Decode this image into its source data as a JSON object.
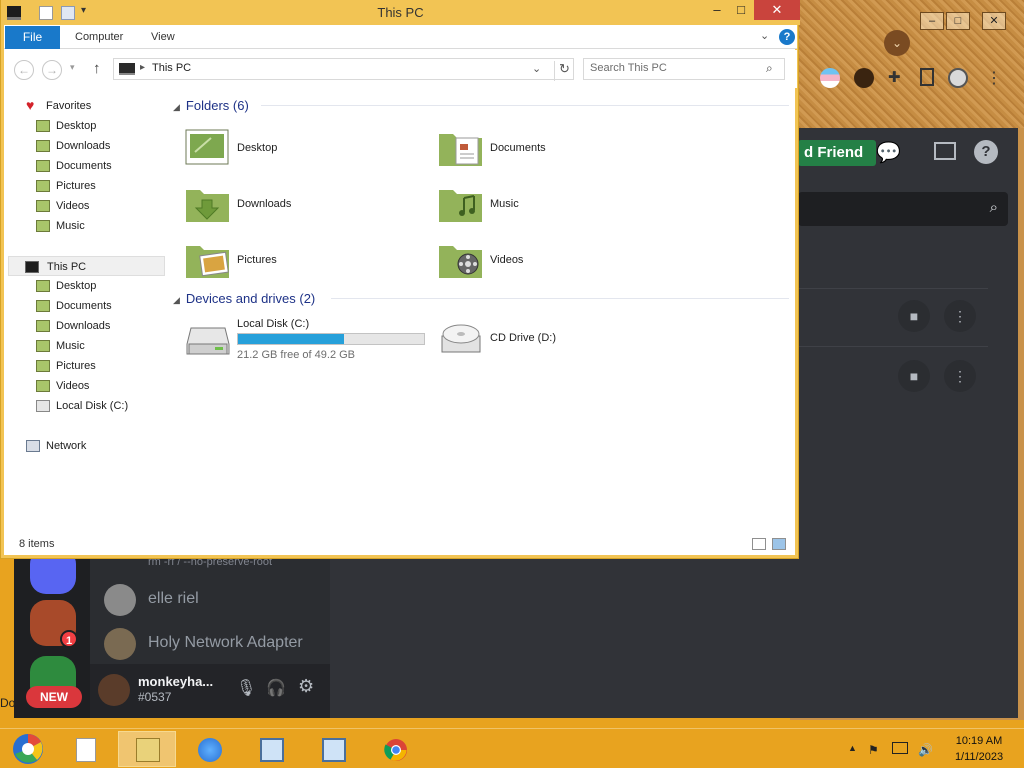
{
  "explorer": {
    "title": "This PC",
    "ribbon": {
      "file_tab": "File",
      "tabs": [
        "Computer",
        "View"
      ]
    },
    "address": {
      "path": "This PC"
    },
    "search": {
      "placeholder": "Search This PC"
    },
    "navpane": {
      "favorites_label": "Favorites",
      "favorites": [
        "Desktop",
        "Downloads",
        "Documents",
        "Pictures",
        "Videos",
        "Music"
      ],
      "this_pc_label": "This PC",
      "this_pc_items": [
        "Desktop",
        "Documents",
        "Downloads",
        "Music",
        "Pictures",
        "Videos",
        "Local Disk (C:)"
      ],
      "network_label": "Network"
    },
    "folders_header": "Folders (6)",
    "folders": [
      "Desktop",
      "Documents",
      "Downloads",
      "Music",
      "Pictures",
      "Videos"
    ],
    "devices_header": "Devices and drives (2)",
    "drives": {
      "c_name": "Local Disk (C:)",
      "c_free": "21.2 GB free of 49.2 GB",
      "c_used_fraction": 0.569,
      "d_name": "CD Drive (D:)"
    },
    "status": "8 items"
  },
  "discord": {
    "add_friend_label": "d Friend",
    "dm_status_line": "rm -rf / --no-preserve-root",
    "dms": [
      "elle riel",
      "Holy Network Adapter"
    ],
    "user": {
      "name": "monkeyha...",
      "tag": "#0537"
    },
    "new_badge": "NEW",
    "notif_count": "1",
    "partial_side_text": "Do"
  },
  "taskbar": {
    "time": "10:19 AM",
    "date": "1/11/2023"
  },
  "colors": {
    "accent": "#1979ca",
    "titlebar": "#f2c454",
    "taskbar": "#e8a31f",
    "discord_bg": "#313338",
    "progress": "#26a0da"
  }
}
